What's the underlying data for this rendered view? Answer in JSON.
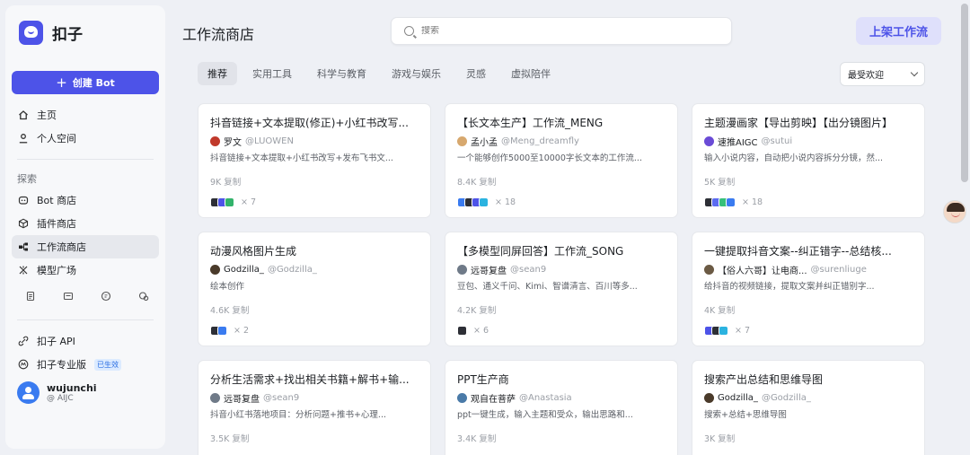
{
  "brand": {
    "name": "扣子"
  },
  "sidebar": {
    "create_label": "创建 Bot",
    "top_items": [
      {
        "label": "主页",
        "icon": "home-icon"
      },
      {
        "label": "个人空间",
        "icon": "person-icon"
      }
    ],
    "explore_label": "探索",
    "explore_items": [
      {
        "label": "Bot 商店",
        "icon": "bot-icon"
      },
      {
        "label": "插件商店",
        "icon": "cube-icon"
      },
      {
        "label": "工作流商店",
        "icon": "workflow-icon",
        "active": true
      },
      {
        "label": "模型广场",
        "icon": "model-icon"
      }
    ],
    "icon_row": [
      "doc-icon",
      "mail-icon",
      "chat-icon",
      "community-icon"
    ],
    "bottom_items": [
      {
        "label": "扣子 API",
        "icon": "api-icon"
      },
      {
        "label": "扣子专业版",
        "icon": "pro-icon",
        "badge": "已生效"
      }
    ],
    "user": {
      "name": "wujunchi",
      "handle": "@ AIJC"
    }
  },
  "header": {
    "title": "工作流商店",
    "search_placeholder": "搜索",
    "publish_label": "上架工作流"
  },
  "tabs": [
    {
      "label": "推荐",
      "active": true
    },
    {
      "label": "实用工具"
    },
    {
      "label": "科学与教育"
    },
    {
      "label": "游戏与娱乐"
    },
    {
      "label": "灵感"
    },
    {
      "label": "虚拟陪伴"
    }
  ],
  "sort": {
    "selected": "最受欢迎"
  },
  "cards": [
    {
      "title": "抖音链接+文本提取(修正)+小红书改写...",
      "author": "罗文",
      "handle": "@LUOWEN",
      "desc": "抖音链接+文本提取+小红书改写+发布飞书文...",
      "copies": "9K 复制",
      "plugin_count": "× 7",
      "avatar_color": "#c0392b",
      "plugin_colors": [
        "#2d2f36",
        "#4d53e8",
        "#32b36b"
      ]
    },
    {
      "title": "【长文本生产】工作流_MENG",
      "author": "孟小孟",
      "handle": "@Meng_dreamfly",
      "desc": "一个能够创作5000至10000字长文本的工作流...",
      "copies": "8.4K 复制",
      "plugin_count": "× 18",
      "avatar_color": "#d7a86e",
      "plugin_colors": [
        "#3a7bf0",
        "#2d2f36",
        "#4d53e8",
        "#2bb3e0"
      ]
    },
    {
      "title": "主题漫画家【导出剪映】【出分镜图片】",
      "author": "速推AIGC",
      "handle": "@sutui",
      "desc": "输入小说内容，自动把小说内容拆分分镜，然...",
      "copies": "5K 复制",
      "plugin_count": "× 18",
      "avatar_color": "#6a4bd6",
      "plugin_colors": [
        "#2d2f36",
        "#5b6bf0",
        "#36c07a",
        "#3a7bf0"
      ]
    },
    {
      "title": "动漫风格图片生成",
      "author": "Godzilla_",
      "handle": "@Godzilla_",
      "desc": "绘本创作",
      "copies": "4.6K 复制",
      "plugin_count": "× 2",
      "avatar_color": "#4a3a2a",
      "plugin_colors": [
        "#2d2f36",
        "#3a7bf0"
      ]
    },
    {
      "title": "【多模型同屏回答】工作流_SONG",
      "author": "远哥复盘",
      "handle": "@sean9",
      "desc": "豆包、通义千问、Kimi、智谱清言、百川等多...",
      "copies": "4.2K 复制",
      "plugin_count": "× 6",
      "avatar_color": "#6f7a88",
      "plugin_colors": [
        "#2d2f36"
      ]
    },
    {
      "title": "一键提取抖音文案--纠正错字--总结核...",
      "author": "【俗人六哥】让电商...",
      "handle": "@surenliuge",
      "desc": "给抖音的视频链接，提取文案并纠正错别字...",
      "copies": "4K 复制",
      "plugin_count": "× 7",
      "avatar_color": "#6b5a44",
      "plugin_colors": [
        "#4d53e8",
        "#2d2f36",
        "#2bb3e0"
      ]
    },
    {
      "title": "分析生活需求+找出相关书籍+解书+输...",
      "author": "远哥复盘",
      "handle": "@sean9",
      "desc": "抖音小红书落地项目：分析问题+推书+心理...",
      "copies": "3.5K 复制",
      "plugin_count": "",
      "avatar_color": "#6f7a88",
      "plugin_colors": []
    },
    {
      "title": "PPT生产商",
      "author": "观自在菩萨",
      "handle": "@Anastasia",
      "desc": "ppt一键生成，输入主题和受众，输出思路和...",
      "copies": "3.4K 复制",
      "plugin_count": "",
      "avatar_color": "#4a7aa8",
      "plugin_colors": []
    },
    {
      "title": "搜索产出总结和思维导图",
      "author": "Godzilla_",
      "handle": "@Godzilla_",
      "desc": "搜索+总结+思维导图",
      "copies": "3K 复制",
      "plugin_count": "",
      "avatar_color": "#4a3a2a",
      "plugin_colors": []
    }
  ]
}
